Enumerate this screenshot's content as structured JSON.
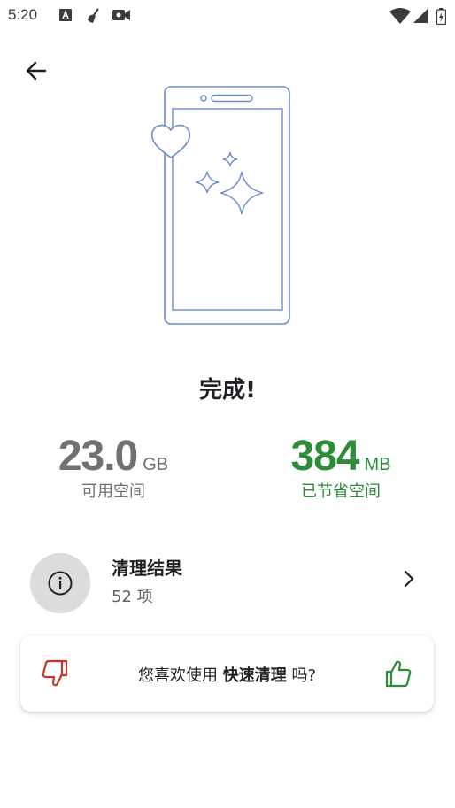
{
  "status_bar": {
    "time": "5:20"
  },
  "header": {
    "back_icon": "arrow-left-icon"
  },
  "main": {
    "title": "完成!",
    "stats": [
      {
        "value": "23.0",
        "unit": "GB",
        "label": "可用空间",
        "color": "#6f7174"
      },
      {
        "value": "384",
        "unit": "MB",
        "label": "已节省空间",
        "color": "#2e8b3a"
      }
    ]
  },
  "result": {
    "title": "清理结果",
    "count": "52 项",
    "icon": "info-icon"
  },
  "feedback": {
    "prefix": "您喜欢使用 ",
    "feature": "快速清理",
    "suffix": " 吗?",
    "dislike_color": "#c0392b",
    "like_color": "#2e8b3a"
  }
}
